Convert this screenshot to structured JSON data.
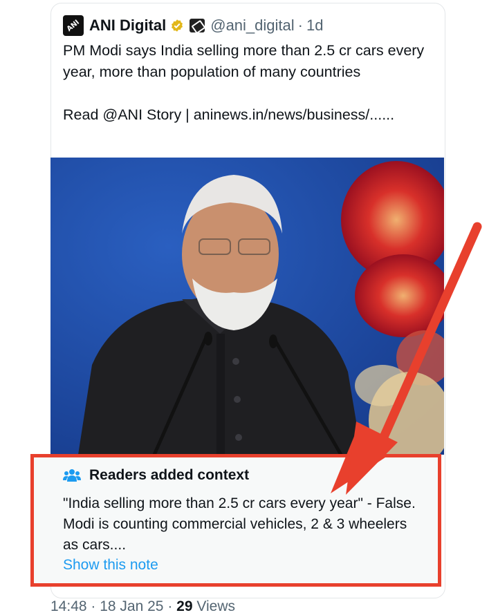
{
  "tweet": {
    "author_name": "ANI Digital",
    "handle": "@ani_digital",
    "separator": "·",
    "age": "1d",
    "text": "PM Modi says India selling more than 2.5 cr cars every year, more than population of many countries\n\nRead @ANI Story | aninews.in/news/business/......",
    "avatar_text": "ANI"
  },
  "context_note": {
    "title": "Readers added context",
    "body": "\"India selling more than 2.5 cr cars every year\" - False. Modi is counting commercial vehicles, 2 & 3 wheelers as cars....",
    "link": "Show this note"
  },
  "footer": {
    "time": "14:48",
    "sep1": " · ",
    "date": "18 Jan 25",
    "sep2": " · ",
    "views_count": "29",
    "views_label": " Views"
  },
  "colors": {
    "highlight": "#e8402d",
    "link": "#1d9bf0",
    "verified": "#e2b719"
  },
  "icons": [
    "verified-badge-icon",
    "affiliate-icon",
    "people-icon"
  ]
}
